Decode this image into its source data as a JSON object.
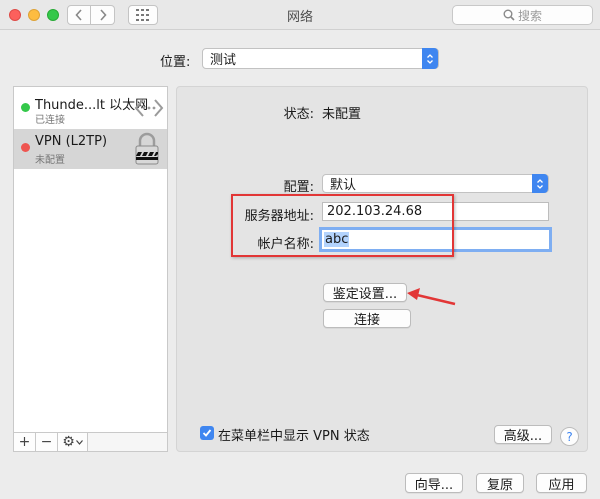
{
  "window": {
    "title": "网络"
  },
  "toolbar": {
    "search_placeholder": "搜索"
  },
  "location": {
    "label": "位置:",
    "value": "测试"
  },
  "services": [
    {
      "name": "Thunde...lt 以太网",
      "status": "已连接",
      "status_color": "#34c84a"
    },
    {
      "name": "VPN (L2TP)",
      "status": "未配置",
      "status_color": "#ee5550"
    }
  ],
  "sidebar_tools": {
    "add": "+",
    "remove": "−",
    "action": "⚙"
  },
  "detail": {
    "status_label": "状态:",
    "status_value": "未配置",
    "config_label": "配置:",
    "config_value": "默认",
    "server_label": "服务器地址:",
    "server_value": "202.103.24.68",
    "account_label": "帐户名称:",
    "account_value": "abc",
    "auth_button": "鉴定设置...",
    "connect_button": "连接",
    "show_vpn_checkbox": "在菜单栏中显示 VPN 状态",
    "show_vpn_checked": true,
    "advanced_button": "高级...",
    "help_button": "?"
  },
  "footer": {
    "assist_button": "向导...",
    "revert_button": "复原",
    "apply_button": "应用"
  },
  "colors": {
    "accent": "#3f86f0",
    "annotation": "#e23636"
  }
}
